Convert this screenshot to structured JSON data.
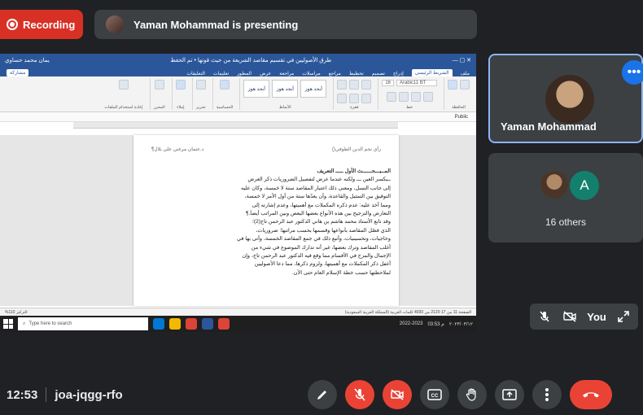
{
  "recording": {
    "label": "Recording"
  },
  "presenting": {
    "text": "Yaman Mohammad is presenting"
  },
  "word": {
    "title": "طرق الأصوليين في تقسيم مقاصد الشريعة من حيث قوتها • تم الحفظ",
    "user": "يمان محمد حساوي",
    "tabs": [
      "ملف",
      "الشريط الرئيسي",
      "إدراج",
      "تصميم",
      "تخطيط",
      "مراجع",
      "مراسلات",
      "مراجعة",
      "عرض",
      "المطور",
      "تعليمات"
    ],
    "active_tab": "الشريط الرئيسي",
    "share": "مشاركة",
    "comments": "التعليقات",
    "font_name": "Arabic11 BT",
    "font_size": "16",
    "style_normal": "أبجد هوز",
    "style_label_normal": "¶ عادي",
    "style_label_h1": "¶ العنوان 1",
    "style_label_h2": "¶ عنوان 2",
    "group_labels": [
      "الحافظة",
      "خط",
      "فقرة",
      "الأنماط",
      "الحساسية",
      "تحرير",
      "إملاء",
      "المحرر",
      "إعادة استخدام الملفات"
    ],
    "sensitivity": "Public",
    "header_right": "رأي نجم الدين الطوفي()",
    "header_left": "د.عثمان مرغني علي بلال¶",
    "lines": [
      "المــبـــحــــــث الأول ـــــ التعريف",
      "ــبكسر العين ـــ ولكنه عندما عرض لتفصيل الضروريات ذكر العرض",
      "إلى جانب النسل، ومعنى ذلك اعتبار المقاصد ستة لا خمسة، وكان عليه",
      "التوفيق بين التمثيل والقاعدة، وأن يعدّها ستة من أول الأمر لا خمسة،",
      "ومما أخذ عليه: عدم ذكره المكملات مع أهميتها، وعدم إشارته إلى",
      "التعارض والترجيح بين هذه الأنواع بعضها البعض وبين المراتب أيضاً.¶",
      "وقد تابع الأستاذ محمد هاشم بن هاني الدكتور عبد الرحمن تاج(2)؛",
      "الذي فصّل المقاصد بأنواعها وقسمها بحسب مراتبها: ضروريات،",
      "وحاجيات، وتحسينيات، وأتبع ذلك في جمع المقاصد الخمسة، وأتى بها في",
      "أغلب المقاصد وترك بعضها، غير أنه تدارك الموضوع في شيء من",
      "الإجمال والمزج في الأقسام مما وقع فيه الدكتور عبد الرحمن تاج، وإن",
      "أغفل ذكر المكملات مع أهميتها، ولزوم ذكرها، مما دعا الأصوليين",
      "لملاحظتها حسب خطة الإسلام العام حتى الآن."
    ],
    "status_left": "الصفحة 11 من 17   2120 من 4030 كلمات   العربية (المملكة العربية السعودية)",
    "status_right": "التركيز   110%",
    "search_placeholder": "Type here to search",
    "tray_time": "03:53 م",
    "tray_date": "٢٠٢٣/٠٣/١٢",
    "tray_year": "2022-2023"
  },
  "self_tile": {
    "name": "Yaman Mohammad"
  },
  "others_tile": {
    "initial": "A",
    "label": "16 others"
  },
  "you_pill": {
    "label": "You"
  },
  "meeting": {
    "time": "12:53",
    "code": "joa-jqgg-rfo"
  },
  "colors": {
    "accent": "#1a73e8",
    "danger": "#ea4335",
    "bg": "#202124",
    "tile": "#3c4043"
  }
}
